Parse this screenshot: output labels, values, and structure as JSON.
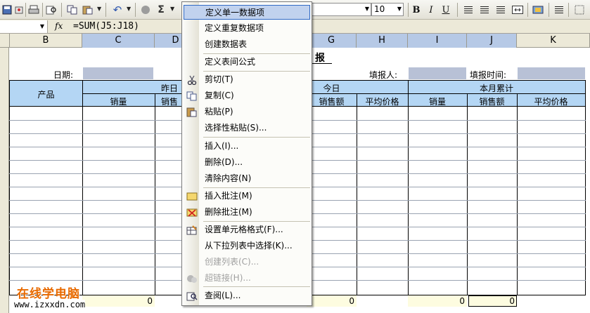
{
  "toolbar": {
    "font_size": "10",
    "bold_label": "B",
    "italic_label": "I",
    "underline_label": "U",
    "sigma_label": "Σ"
  },
  "formula_bar": {
    "name_box_value": "",
    "fx_label": "fx",
    "formula": "=SUM(J5:J18)"
  },
  "columns": [
    "B",
    "C",
    "D",
    "G",
    "H",
    "I",
    "J",
    "K"
  ],
  "sheet": {
    "title_fragment": "报",
    "date_label": "日期:",
    "reporter_label": "填报人:",
    "report_time_label": "填报时间:",
    "product_header": "产品",
    "group_yesterday": "昨日",
    "group_today": "今日",
    "group_month": "本月累计",
    "sub_qty": "销量",
    "sub_amount": "销售额",
    "sub_amount_partial": "销售",
    "sub_avg": "平均价格",
    "totals": [
      "0",
      "0",
      "0",
      "0"
    ]
  },
  "watermark": {
    "line1": "在线学电脑",
    "line2": "www.izxxdn.com"
  },
  "context_menu": {
    "items": [
      {
        "label": "定义单一数据项",
        "highlighted": true
      },
      {
        "label": "定义重复数据项"
      },
      {
        "label": "创建数据表"
      },
      {
        "label": "定义表间公式"
      },
      {
        "label": "剪切(T)",
        "icon": "scissors-icon"
      },
      {
        "label": "复制(C)",
        "icon": "copy-icon"
      },
      {
        "label": "粘贴(P)",
        "icon": "paste-icon"
      },
      {
        "label": "选择性粘贴(S)..."
      },
      {
        "label": "插入(I)..."
      },
      {
        "label": "删除(D)..."
      },
      {
        "label": "清除内容(N)"
      },
      {
        "label": "插入批注(M)",
        "icon": "insert-comment-icon"
      },
      {
        "label": "删除批注(M)",
        "icon": "delete-comment-icon"
      },
      {
        "label": "设置单元格格式(F)...",
        "icon": "format-cells-icon"
      },
      {
        "label": "从下拉列表中选择(K)..."
      },
      {
        "label": "创建列表(C)...",
        "disabled": true
      },
      {
        "label": "超链接(H)...",
        "disabled": true,
        "icon": "hyperlink-icon"
      },
      {
        "label": "查阅(L)...",
        "icon": "lookup-icon"
      }
    ]
  }
}
